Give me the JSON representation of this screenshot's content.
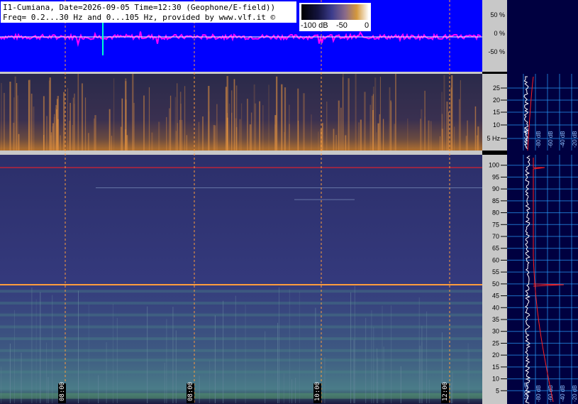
{
  "header": {
    "line1": "I1-Cumiana, Date=2026-09-05 Time=12:30 (Geophone/E-field))",
    "line2": "Freq= 0.2...30 Hz and 0...105 Hz, provided by www.vlf.it ©"
  },
  "colorbar": {
    "ticks": [
      "-100 dB",
      "-50",
      "0"
    ]
  },
  "colors": {
    "waveform_bg": "#0000ff",
    "waveform_trace": "#ff00ff",
    "waveform_center": "#ffffff",
    "marker_orange": "#ff9c3c",
    "side_panel_bg": "#000040",
    "axis_panel_bg": "#c8c8c8",
    "grid_blue": "#2aa0ff",
    "line_red": "#ff2020"
  },
  "chart_data": [
    {
      "type": "line",
      "name": "waveform-amplitude",
      "ylabel_ticks": [
        "50 %",
        "0 %",
        "-50 %"
      ],
      "ylim": [
        -100,
        100
      ]
    },
    {
      "type": "heatmap",
      "name": "spectrogram-low",
      "y_ticks": [
        "25",
        "20",
        "15",
        "10",
        "5 Hz"
      ],
      "ylim": [
        0.2,
        30
      ]
    },
    {
      "type": "heatmap",
      "name": "spectrogram-high",
      "y_ticks": [
        "100",
        "95",
        "90",
        "85",
        "80",
        "75",
        "70",
        "65",
        "60",
        "55",
        "50",
        "45",
        "40",
        "35",
        "30",
        "25",
        "20",
        "15",
        "10",
        "5"
      ],
      "ylim": [
        0,
        105
      ],
      "x_ticks": [
        "08:00",
        "08:00",
        "10:00",
        "12:00"
      ],
      "horizontal_lines_hz": [
        100,
        50
      ]
    },
    {
      "type": "line",
      "name": "average-spectrum",
      "x_ticks": [
        "-100 dB",
        "-80 dB",
        "-60 dB",
        "-40 dB",
        "-20 dB"
      ],
      "x_ticks_top": [
        "-100 dB",
        "-80 dB",
        "-60 dB",
        "-40 dB",
        "-20 dB"
      ]
    }
  ]
}
